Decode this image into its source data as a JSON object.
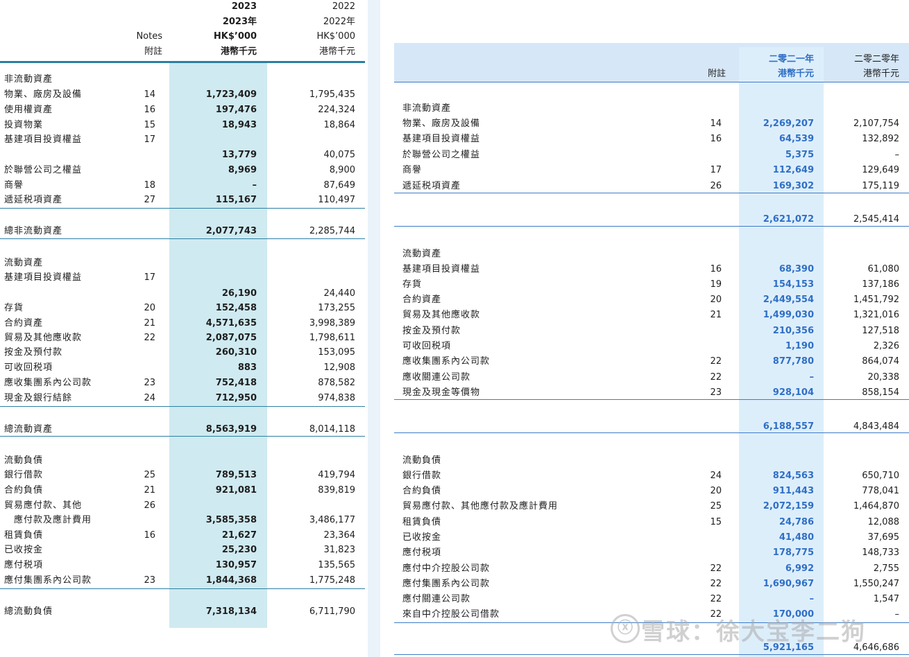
{
  "left": {
    "header": {
      "y1_year_en": "2023",
      "y1_year_zh": "2023年",
      "y1_unit_en": "HK$’000",
      "y1_unit_zh": "港幣千元",
      "y2_year_en": "2022",
      "y2_year_zh": "2022年",
      "y2_unit_en": "HK$’000",
      "y2_unit_zh": "港幣千元",
      "notes_en": "Notes",
      "notes_zh": "附註"
    },
    "rows": [
      {
        "label": "非流動資產",
        "note": "",
        "v1": "",
        "v2": ""
      },
      {
        "label": "物業、廠房及設備",
        "note": "14",
        "v1": "1,723,409",
        "v2": "1,795,435"
      },
      {
        "label": "使用權資產",
        "note": "16",
        "v1": "197,476",
        "v2": "224,324"
      },
      {
        "label": "投資物業",
        "note": "15",
        "v1": "18,943",
        "v2": "18,864"
      },
      {
        "label": "基建項目投資權益",
        "note": "17",
        "v1": "",
        "v2": ""
      },
      {
        "label": "",
        "note": "",
        "v1": "13,779",
        "v2": "40,075"
      },
      {
        "label": "於聯營公司之權益",
        "note": "",
        "v1": "8,969",
        "v2": "8,900"
      },
      {
        "label": "商譽",
        "note": "18",
        "v1": "–",
        "v2": "87,649"
      },
      {
        "label": "遞延税項資產",
        "note": "27",
        "v1": "115,167",
        "v2": "110,497"
      },
      {
        "label": "總非流動資產",
        "note": "",
        "v1": "2,077,743",
        "v2": "2,285,744"
      },
      {
        "label": "流動資產",
        "note": "",
        "v1": "",
        "v2": ""
      },
      {
        "label": "基建項目投資權益",
        "note": "17",
        "v1": "",
        "v2": ""
      },
      {
        "label": "",
        "note": "",
        "v1": "26,190",
        "v2": "24,440"
      },
      {
        "label": "存貨",
        "note": "20",
        "v1": "152,458",
        "v2": "173,255"
      },
      {
        "label": "合約資產",
        "note": "21",
        "v1": "4,571,635",
        "v2": "3,998,389"
      },
      {
        "label": "貿易及其他應收款",
        "note": "22",
        "v1": "2,087,075",
        "v2": "1,798,611"
      },
      {
        "label": "按金及預付款",
        "note": "",
        "v1": "260,310",
        "v2": "153,095"
      },
      {
        "label": "可收回税項",
        "note": "",
        "v1": "883",
        "v2": "12,908"
      },
      {
        "label": "應收集團系內公司款",
        "note": "23",
        "v1": "752,418",
        "v2": "878,582"
      },
      {
        "label": "現金及銀行結餘",
        "note": "24",
        "v1": "712,950",
        "v2": "974,838"
      },
      {
        "label": "總流動資產",
        "note": "",
        "v1": "8,563,919",
        "v2": "8,014,118"
      },
      {
        "label": "流動負債",
        "note": "",
        "v1": "",
        "v2": ""
      },
      {
        "label": "銀行借款",
        "note": "25",
        "v1": "789,513",
        "v2": "419,794"
      },
      {
        "label": "合約負債",
        "note": "21",
        "v1": "921,081",
        "v2": "839,819"
      },
      {
        "label": "貿易應付款、其他",
        "note": "26",
        "v1": "",
        "v2": ""
      },
      {
        "label": "　應付款及應計費用",
        "note": "",
        "v1": "3,585,358",
        "v2": "3,486,177"
      },
      {
        "label": "租賃負債",
        "note": "16",
        "v1": "21,627",
        "v2": "23,364"
      },
      {
        "label": "已收按金",
        "note": "",
        "v1": "25,230",
        "v2": "31,823"
      },
      {
        "label": "應付税項",
        "note": "",
        "v1": "130,957",
        "v2": "135,565"
      },
      {
        "label": "應付集團系內公司款",
        "note": "23",
        "v1": "1,844,368",
        "v2": "1,775,248"
      },
      {
        "label": "總流動負債",
        "note": "",
        "v1": "7,318,134",
        "v2": "6,711,790"
      }
    ]
  },
  "right": {
    "header": {
      "notes_zh": "附註",
      "y1_year_zh": "二零二一年",
      "y1_unit_zh": "港幣千元",
      "y2_year_zh": "二零二零年",
      "y2_unit_zh": "港幣千元"
    },
    "rows": [
      {
        "label": "非流動資產",
        "note": "",
        "v1": "",
        "v2": ""
      },
      {
        "label": "物業、廠房及設備",
        "note": "14",
        "v1": "2,269,207",
        "v2": "2,107,754"
      },
      {
        "label": "基建項目投資權益",
        "note": "16",
        "v1": "64,539",
        "v2": "132,892"
      },
      {
        "label": "於聯營公司之權益",
        "note": "",
        "v1": "5,375",
        "v2": "–"
      },
      {
        "label": "商譽",
        "note": "17",
        "v1": "112,649",
        "v2": "129,649"
      },
      {
        "label": "遞延税項資產",
        "note": "26",
        "v1": "169,302",
        "v2": "175,119"
      },
      {
        "label": "",
        "note": "",
        "v1": "2,621,072",
        "v2": "2,545,414"
      },
      {
        "label": "流動資產",
        "note": "",
        "v1": "",
        "v2": ""
      },
      {
        "label": "基建項目投資權益",
        "note": "16",
        "v1": "68,390",
        "v2": "61,080"
      },
      {
        "label": "存貨",
        "note": "19",
        "v1": "154,153",
        "v2": "137,186"
      },
      {
        "label": "合約資產",
        "note": "20",
        "v1": "2,449,554",
        "v2": "1,451,792"
      },
      {
        "label": "貿易及其他應收款",
        "note": "21",
        "v1": "1,499,030",
        "v2": "1,321,016"
      },
      {
        "label": "按金及預付款",
        "note": "",
        "v1": "210,356",
        "v2": "127,518"
      },
      {
        "label": "可收回税項",
        "note": "",
        "v1": "1,190",
        "v2": "2,326"
      },
      {
        "label": "應收集團系內公司款",
        "note": "22",
        "v1": "877,780",
        "v2": "864,074"
      },
      {
        "label": "應收關連公司款",
        "note": "22",
        "v1": "–",
        "v2": "20,338"
      },
      {
        "label": "現金及現金等價物",
        "note": "23",
        "v1": "928,104",
        "v2": "858,154"
      },
      {
        "label": "",
        "note": "",
        "v1": "6,188,557",
        "v2": "4,843,484"
      },
      {
        "label": "流動負債",
        "note": "",
        "v1": "",
        "v2": ""
      },
      {
        "label": "銀行借款",
        "note": "24",
        "v1": "824,563",
        "v2": "650,710"
      },
      {
        "label": "合約負債",
        "note": "20",
        "v1": "911,443",
        "v2": "778,041"
      },
      {
        "label": "貿易應付款、其他應付款及應計費用",
        "note": "25",
        "v1": "2,072,159",
        "v2": "1,464,870"
      },
      {
        "label": "租賃負債",
        "note": "15",
        "v1": "24,786",
        "v2": "12,088"
      },
      {
        "label": "已收按金",
        "note": "",
        "v1": "41,480",
        "v2": "37,695"
      },
      {
        "label": "應付税項",
        "note": "",
        "v1": "178,775",
        "v2": "148,733"
      },
      {
        "label": "應付中介控股公司款",
        "note": "22",
        "v1": "6,992",
        "v2": "2,755"
      },
      {
        "label": "應付集團系內公司款",
        "note": "22",
        "v1": "1,690,967",
        "v2": "1,550,247"
      },
      {
        "label": "應付關連公司款",
        "note": "22",
        "v1": "–",
        "v2": "1,547"
      },
      {
        "label": "來自中介控股公司借款",
        "note": "22",
        "v1": "170,000",
        "v2": "–"
      },
      {
        "label": "",
        "note": "",
        "v1": "5,921,165",
        "v2": "4,646,686"
      }
    ]
  },
  "watermark": {
    "icon_glyph": "ⓧ",
    "text": "雪球：徐大宝李二狗"
  }
}
